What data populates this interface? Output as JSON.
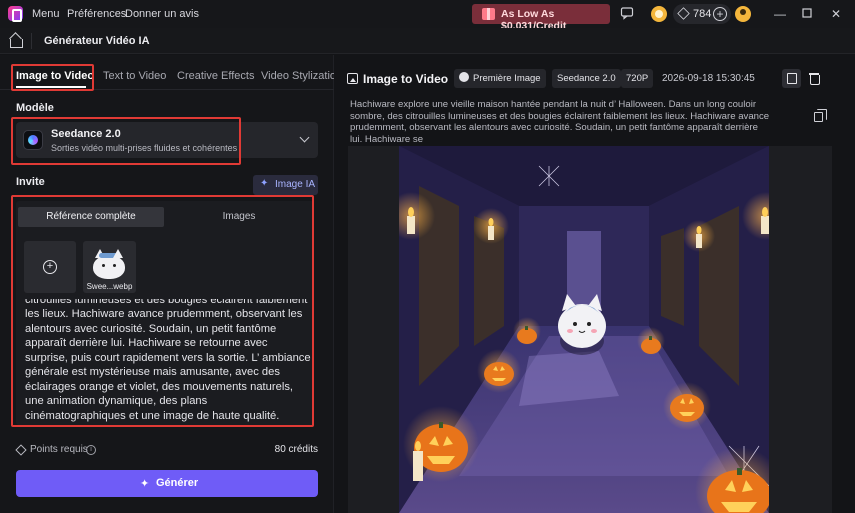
{
  "titlebar": {
    "menu": [
      "Menu",
      "Préférences",
      "Donner un avis"
    ],
    "promo": "As Low As $0.031/Credit",
    "credits": "784"
  },
  "subheader": {
    "title": "Générateur Vidéo IA"
  },
  "left": {
    "tabs": [
      "Image to Video",
      "Text to Video",
      "Creative Effects",
      "Video Stylization"
    ],
    "model_label": "Modèle",
    "model_name": "Seedance 2.0",
    "model_desc": "Sorties vidéo multi-prises fluides et cohérentes",
    "prompt_label": "Invite",
    "image_ia": "Image IA",
    "segments": [
      "Référence complète",
      "Images"
    ],
    "thumb_name": "Swee...webp",
    "prompt_text": "Hachiware explore une vieille maison hantée pendant la nuit d’ Halloween. Dans un long couloir sombre, des citrouilles lumineuses et des bougies éclairent faiblement les lieux. Hachiware avance prudemment, observant les alentours avec curiosité. Soudain, un petit fantôme apparaît derrière lui. Hachiware se retourne avec surprise, puis court rapidement vers la sortie. L’ ambiance générale est mystérieuse mais amusante, avec des éclairages orange et violet, des mouvements naturels, une animation dynamique, des plans cinématographiques et une image de haute qualité.",
    "points_label": "Points requis",
    "points_value": "80 crédits",
    "generate": "Générer"
  },
  "right": {
    "title": "Image to Video",
    "chips": [
      "Première Image",
      "Seedance 2.0",
      "720P"
    ],
    "date": "2026-09-18 15:30:45",
    "description": "Hachiware explore une vieille maison hantée pendant la nuit d’ Halloween. Dans un long couloir sombre, des citrouilles lumineuses et des bougies éclairent faiblement les lieux. Hachiware avance prudemment, observant les alentours avec curiosité. Soudain, un petit fantôme apparaît derrière lui. Hachiware se"
  },
  "colors": {
    "accent": "#6f5cf7",
    "highlight": "#e03a35",
    "promo": "#7a2e3a"
  }
}
